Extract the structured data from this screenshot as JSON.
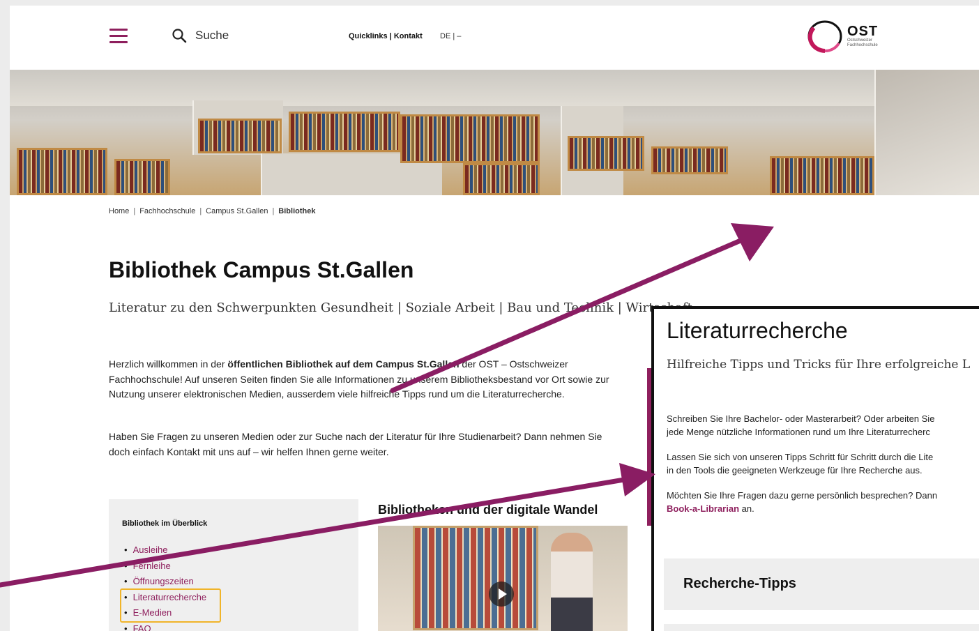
{
  "header": {
    "menu_icon": "hamburger-menu-icon",
    "search_icon": "search-icon",
    "search_label": "Suche",
    "quicklinks": "Quicklinks | Kontakt",
    "language": "DE | –",
    "logo_text": "OST",
    "logo_sub1": "Ostschweizer",
    "logo_sub2": "Fachhochschule",
    "accent_color": "#8e1f5d"
  },
  "breadcrumb": {
    "items": [
      "Home",
      "Fachhochschule",
      "Campus St.Gallen"
    ],
    "current": "Bibliothek"
  },
  "main": {
    "title": "Bibliothek Campus St.Gallen",
    "subtitle": "Literatur zu den Schwerpunkten Gesundheit | Soziale Arbeit | Bau und Technik | Wirtschaft",
    "intro_pre": "Herzlich willkommen in der ",
    "intro_bold": "öffentlichen Bibliothek auf dem Campus St.Gallen",
    "intro_post": " der OST – Ostschweizer Fachhochschule! Auf unseren Seiten finden Sie alle Informationen zu unserem Bibliotheksbestand vor Ort sowie zur Nutzung unserer elektronischen Medien, ausserdem viele hilfreiche Tipps rund um die Literaturrecherche.",
    "intro2": "Haben Sie Fragen zu unseren Medien oder zur Suche nach der Literatur für Ihre Studienarbeit? Dann nehmen Sie doch einfach Kontakt mit uns auf – wir helfen Ihnen gerne weiter."
  },
  "overview": {
    "heading": "Bibliothek im Überblick",
    "items": [
      "Ausleihe",
      "Fernleihe",
      "Öffnungszeiten",
      "Literaturrecherche",
      "E-Medien",
      "FAQ"
    ]
  },
  "video": {
    "title": "Bibliotheken und der digitale Wandel",
    "play_icon": "play-icon"
  },
  "overlay": {
    "title": "Literaturrecherche",
    "subtitle": "Hilfreiche Tipps und Tricks für Ihre erfolgreiche L",
    "p1_line1": "Schreiben Sie Ihre Bachelor- oder Masterarbeit? Oder arbeiten Sie",
    "p1_line2": "jede Menge nützliche Informationen rund um Ihre Literaturrecherc",
    "p2_line1": "Lassen Sie sich von unseren Tipps Schritt für Schritt durch die Lite",
    "p2_line2": "in den Tools die geeigneten Werkzeuge für Ihre Recherche aus.",
    "p3_line1": "Möchten Sie Ihre Fragen dazu gerne persönlich besprechen? Dann",
    "p3_link": "Book-a-Librarian",
    "p3_tail": " an.",
    "accordion1": "Recherche-Tipps"
  },
  "annotation": {
    "arrow_color": "#8a1d63",
    "highlight_color": "#f0b429"
  }
}
